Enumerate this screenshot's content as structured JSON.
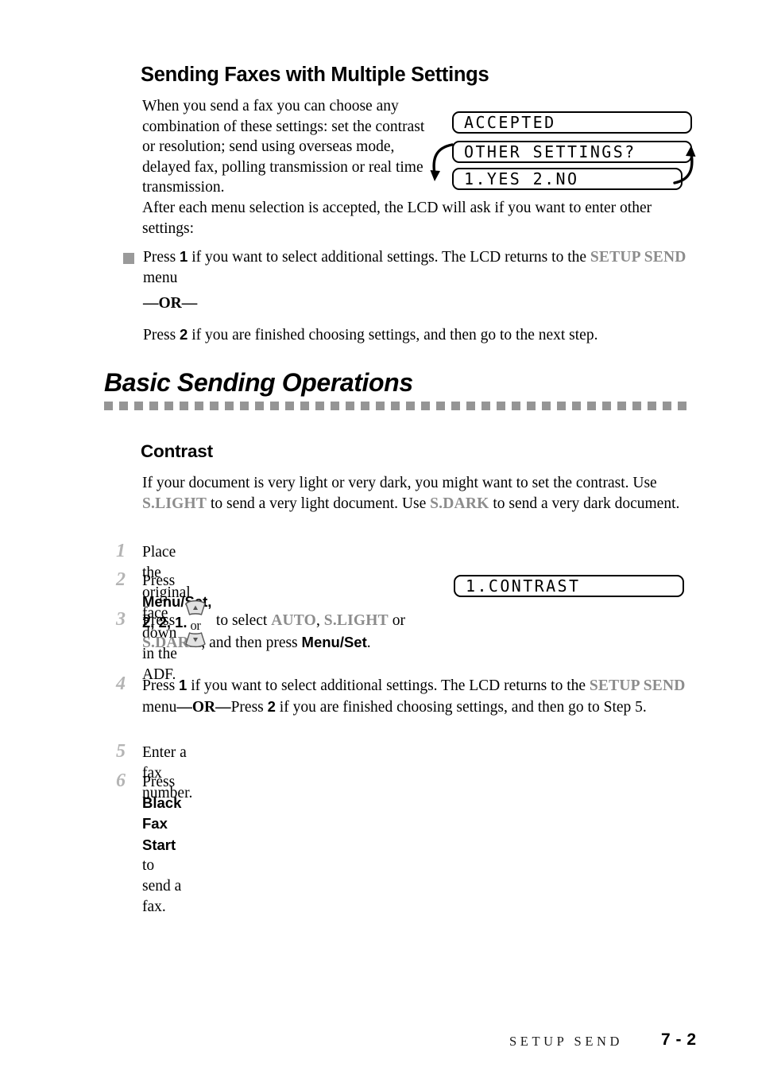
{
  "document": {
    "section_heading": "Sending Faxes with Multiple Settings",
    "chapter_heading": "Basic Sending Operations",
    "subsection_heading": "Contrast"
  },
  "intro": {
    "paragraph": "When you send a fax you can choose any combination of these settings: set the contrast or resolution; send using overseas mode, delayed fax, polling transmission or real time transmission.",
    "after_menu_text": "After each menu selection is accepted, the LCD will ask if you want to enter other settings:"
  },
  "bullet": {
    "text_1": "Press ",
    "key_1": "1",
    "text_2": " if you want to select additional settings. The LCD returns to the ",
    "menu_name": "SETUP SEND",
    "text_3": " menu"
  },
  "or_divider": "—OR—",
  "press2": {
    "text_1": "Press ",
    "key": "2",
    "text_2": " if you are finished choosing settings, and then go to the next step."
  },
  "contrast": {
    "paragraph_1": "If your document is very light or very dark, you might want to set the contrast. Use ",
    "mode_light": "S.LIGHT",
    "paragraph_2": " to send a very light document. Use ",
    "mode_dark": "S.DARK",
    "paragraph_3": " to send a very dark document."
  },
  "steps": [
    {
      "number": "1",
      "text": "Place the original face down in the ADF."
    },
    {
      "number": "2",
      "press_label": "Press ",
      "button": "Menu/Set",
      "keys": ", 2, 2, 1."
    },
    {
      "number": "3",
      "press_label": "Press ",
      "icon_label": "or",
      "to_select": " to select ",
      "option_auto": "AUTO",
      "comma": ", ",
      "option_slight": "S.LIGHT",
      "or_text": " or",
      "option_sdark": "S.DARK",
      "then_press": ", and then press ",
      "button": "Menu/Set",
      "period": "."
    },
    {
      "number": "4",
      "text_1": "Press ",
      "key_1": "1",
      "text_2": " if you want to select additional settings. The LCD returns to the ",
      "menu_name": "SETUP SEND",
      "text_3": " menu",
      "or_divider": "—OR—",
      "text_4": "Press ",
      "key_2": "2",
      "text_5": " if you are finished choosing settings, and then go to Step 5."
    },
    {
      "number": "5",
      "text": "Enter a fax number."
    },
    {
      "number": "6",
      "press_label": "Press ",
      "button": "Black Fax Start",
      "text": " to send a fax."
    }
  ],
  "lcd_displays": [
    {
      "name": "accepted",
      "text": "ACCEPTED"
    },
    {
      "name": "other-settings",
      "text": "OTHER SETTINGS?"
    },
    {
      "name": "yes-no",
      "text": "1.YES 2.NO"
    },
    {
      "name": "contrast-menu",
      "text": "1.CONTRAST"
    }
  ],
  "footer": {
    "label": "SETUP SEND",
    "page": "7 - 2"
  },
  "colors": {
    "gray_accent": "#8c8c8c",
    "rule_gray": "#959595",
    "step_number_gray": "#b4b4b4",
    "black": "#000000"
  }
}
